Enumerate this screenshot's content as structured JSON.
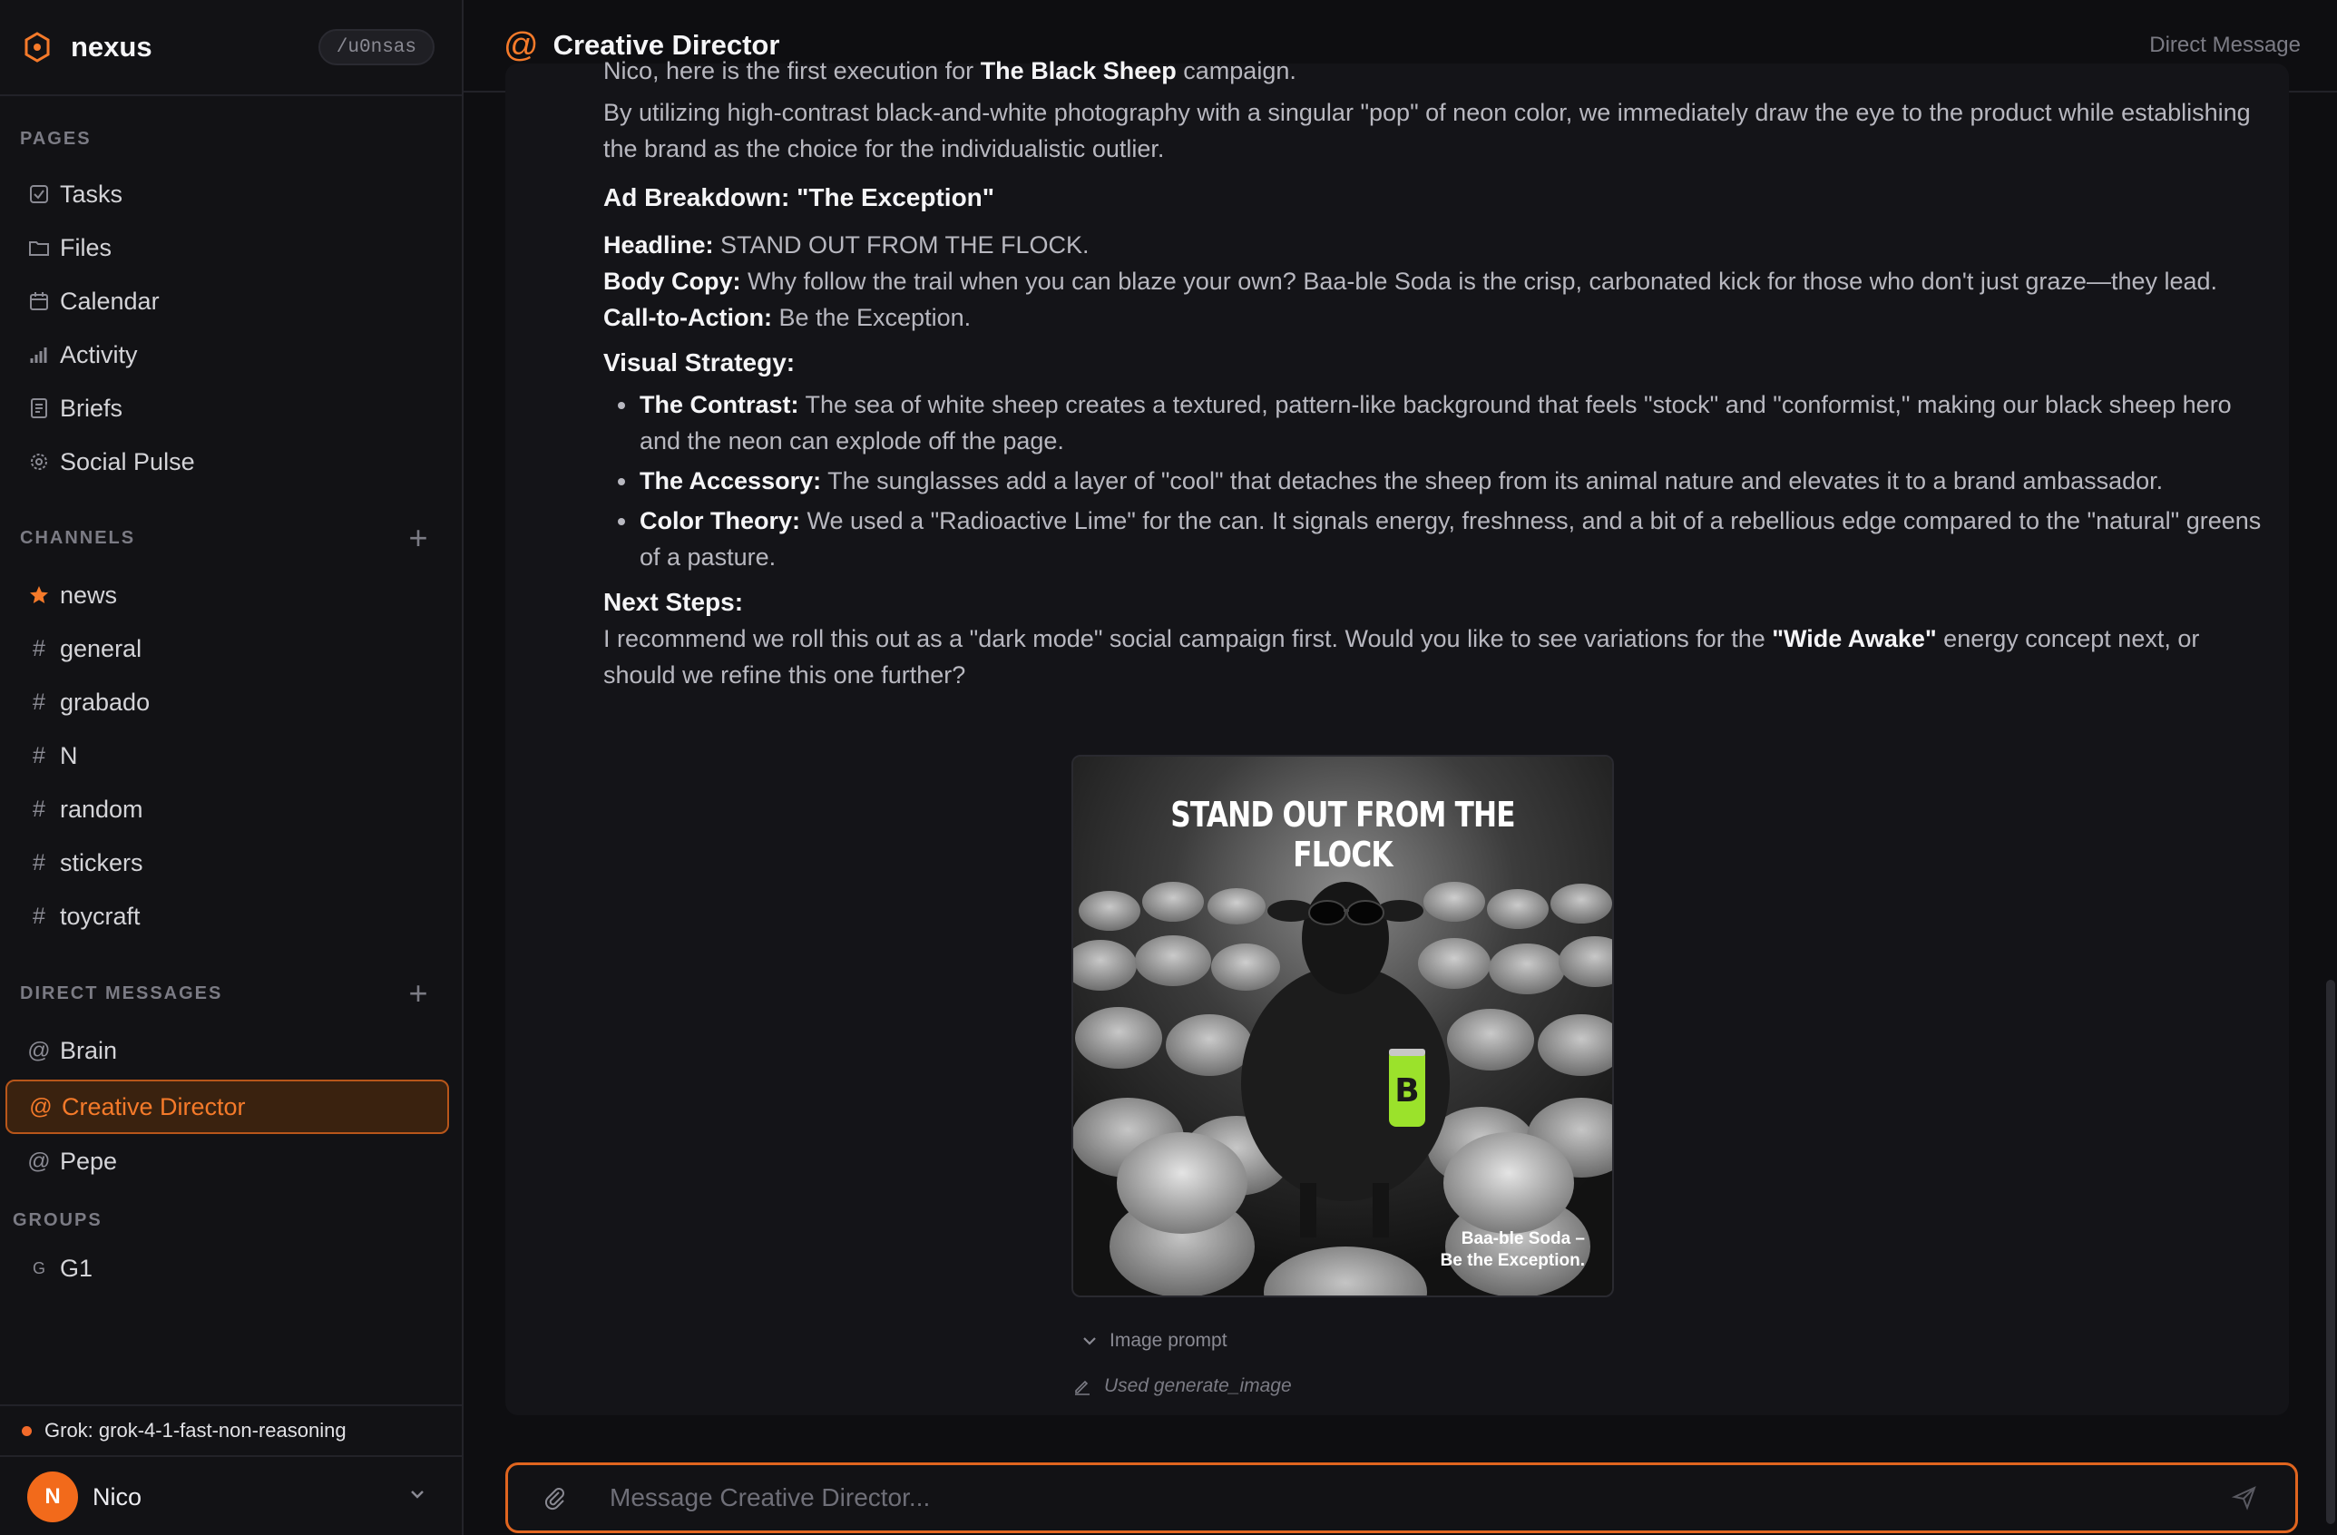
{
  "brand": {
    "name": "nexus",
    "user_tag": "/u0nsas"
  },
  "sidebar": {
    "pages_heading": "PAGES",
    "pages": [
      {
        "label": "Tasks",
        "icon": "checkbox-icon"
      },
      {
        "label": "Files",
        "icon": "folder-icon"
      },
      {
        "label": "Calendar",
        "icon": "calendar-icon"
      },
      {
        "label": "Activity",
        "icon": "bar-chart-icon"
      },
      {
        "label": "Briefs",
        "icon": "document-icon"
      },
      {
        "label": "Social Pulse",
        "icon": "radar-icon"
      }
    ],
    "channels_heading": "CHANNELS",
    "channels": [
      {
        "label": "news",
        "icon": "star-icon"
      },
      {
        "label": "general",
        "icon": "hash-icon"
      },
      {
        "label": "grabado",
        "icon": "hash-icon"
      },
      {
        "label": "N",
        "icon": "hash-icon"
      },
      {
        "label": "random",
        "icon": "hash-icon"
      },
      {
        "label": "stickers",
        "icon": "hash-icon"
      },
      {
        "label": "toycraft",
        "icon": "hash-icon"
      }
    ],
    "dms_heading": "DIRECT MESSAGES",
    "dms": [
      {
        "label": "Brain",
        "icon": "at-icon"
      },
      {
        "label": "Creative Director",
        "icon": "at-icon",
        "active": true
      },
      {
        "label": "Pepe",
        "icon": "at-icon"
      }
    ],
    "groups_heading": "GROUPS",
    "groups": [
      {
        "label": "G1",
        "icon": "G"
      }
    ],
    "model_status": "Grok: grok-4-1-fast-non-reasoning",
    "user": {
      "initial": "N",
      "name": "Nico"
    }
  },
  "header": {
    "at": "@",
    "title": "Creative Director",
    "kind": "Direct Message"
  },
  "message": {
    "intro_prefix": "Nico, here is the first execution for ",
    "intro_bold": "The Black Sheep",
    "intro_suffix": " campaign.",
    "para1": "By utilizing high-contrast black-and-white photography with a singular \"pop\" of neon color, we immediately draw the eye to the product while establishing the brand as the choice for the individualistic outlier.",
    "breakdown_heading": "Ad Breakdown: \"The Exception\"",
    "headline_label": "Headline:",
    "headline_value": " STAND OUT FROM THE FLOCK.",
    "body_label": "Body Copy:",
    "body_value": " Why follow the trail when you can blaze your own? Baa-ble Soda is the crisp, carbonated kick for those who don't just graze—they lead.",
    "cta_label": "Call-to-Action:",
    "cta_value": " Be the Exception.",
    "visual_heading": "Visual Strategy:",
    "bullets": [
      {
        "label": "The Contrast:",
        "text": " The sea of white sheep creates a textured, pattern-like background that feels \"stock\" and \"conformist,\" making our black sheep hero and the neon can explode off the page."
      },
      {
        "label": "The Accessory:",
        "text": " The sunglasses add a layer of \"cool\" that detaches the sheep from its animal nature and elevates it to a brand ambassador."
      },
      {
        "label": "Color Theory:",
        "text": " We used a \"Radioactive Lime\" for the can. It signals energy, freshness, and a bit of a rebellious edge compared to the \"natural\" greens of a pasture."
      }
    ],
    "next_heading": "Next Steps:",
    "next_prefix": "I recommend we roll this out as a \"dark mode\" social campaign first. Would you like to see variations for the ",
    "next_bold": "\"Wide Awake\"",
    "next_suffix": " energy concept next, or should we refine this one further?",
    "ad_image": {
      "headline": "STAND OUT FROM THE FLOCK",
      "tagline_line1": "Baa-ble Soda –",
      "tagline_line2": "Be the Exception.",
      "can_letter": "B"
    },
    "image_prompt_label": "Image prompt",
    "tool_note": "Used generate_image"
  },
  "composer": {
    "placeholder": "Message Creative Director..."
  },
  "colors": {
    "accent": "#f57a2a",
    "lime": "#9be22b",
    "background": "#0e0e11",
    "sidebar": "#121215"
  }
}
